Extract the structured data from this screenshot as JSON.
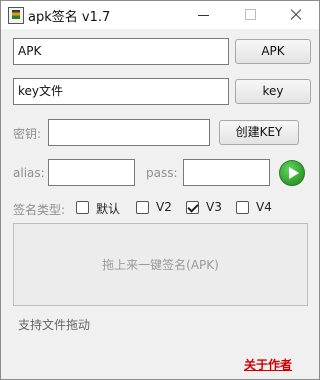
{
  "window": {
    "title": "apk签名 v1.7",
    "controls": {
      "minimize": "minimize",
      "maximize": "maximize",
      "close": "close"
    }
  },
  "apk_row": {
    "value": "APK",
    "button_label": "APK"
  },
  "key_row": {
    "value": "key文件",
    "button_label": "key"
  },
  "password_row": {
    "label": "密钥:",
    "value": "",
    "button_label": "创建KEY"
  },
  "alias_row": {
    "alias_label": "alias:",
    "alias_value": "",
    "pass_label": "pass:",
    "pass_value": "",
    "go_icon": "play-circle-icon"
  },
  "signature": {
    "label": "签名类型:",
    "options": [
      {
        "label": "默认",
        "checked": false
      },
      {
        "label": "V2",
        "checked": false
      },
      {
        "label": "V3",
        "checked": true
      },
      {
        "label": "V4",
        "checked": false
      }
    ]
  },
  "dropzone": {
    "text": "拖上来一键签名(APK)"
  },
  "hint": {
    "text": "支持文件拖动"
  },
  "about": {
    "label": "关于作者",
    "color": "#d00000"
  }
}
